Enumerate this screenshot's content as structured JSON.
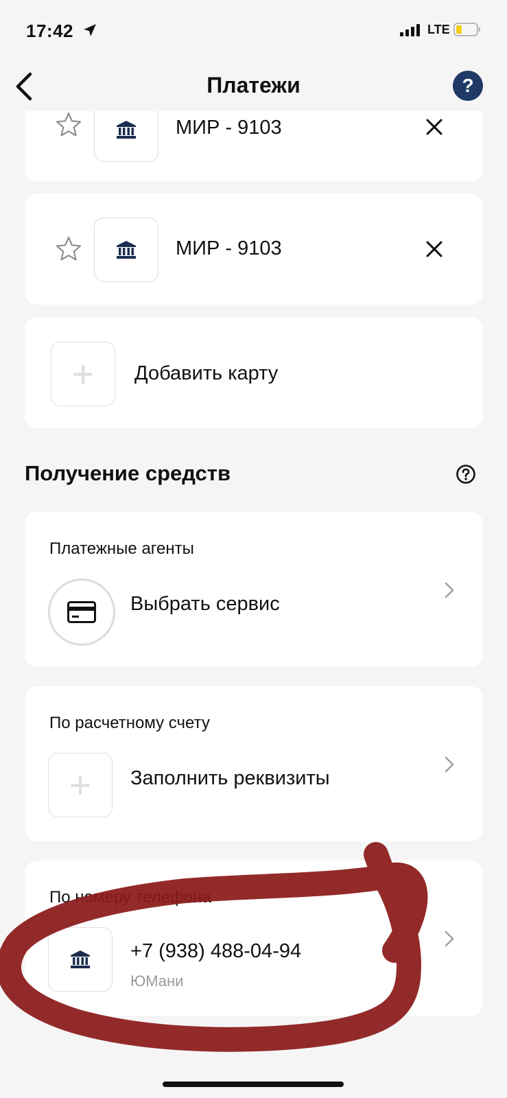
{
  "status_bar": {
    "time": "17:42",
    "network": "LTE"
  },
  "header": {
    "title": "Платежи",
    "help": "?"
  },
  "cards": [
    {
      "label": "МИР - 9103"
    },
    {
      "label": "МИР - 9103"
    }
  ],
  "add_card": {
    "label": "Добавить карту",
    "plus": "+"
  },
  "receive_section": {
    "title": "Получение средств"
  },
  "payment_agents": {
    "title": "Платежные агенты",
    "action": "Выбрать сервис"
  },
  "bank_account": {
    "title": "По расчетному счету",
    "action": "Заполнить реквизиты",
    "plus": "+"
  },
  "phone": {
    "title": "По номеру телефона",
    "number": "+7 (938) 488-04-94",
    "service": "ЮМани"
  },
  "annotation": {
    "color": "#8b1a1a"
  }
}
